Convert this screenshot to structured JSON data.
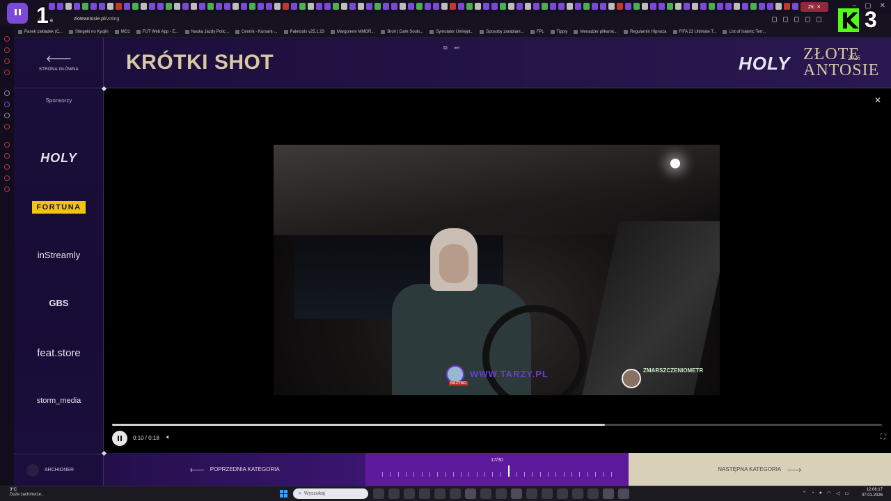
{
  "browser": {
    "url_host": "zloteantosie.pl",
    "url_path": "/voting",
    "active_tab_label": "Złc",
    "bookmarks": [
      "Pasek zakładek (C...",
      "Stingeki no Kyojin",
      "MO1",
      "FUT Web App - E...",
      "Nauka Jazdy Polic...",
      "Cennik - Kursant-...",
      "Paletools v25.1.23",
      "Margonem MMOR...",
      "Broń | Dark Souls...",
      "Symulator Umiejęt...",
      "Sposoby zarabiani...",
      "FPL",
      "Tipply",
      "Menadżer piłkarsk...",
      "Regulamin Hipnoza",
      "FIFA 22 Ultimate T...",
      "List of Islamic Terr..."
    ]
  },
  "sidebar": {
    "home_label": "STRONA GŁÓWNA",
    "sponsors_title": "Sponsorzy",
    "sponsors": {
      "holy": "HOLY",
      "fortuna": "FORTUNA",
      "instreamly": "inStreamly",
      "gbs": "GBS",
      "featstore": "feat.store",
      "storm": "storm_media"
    },
    "user_label": "ARCHIONER"
  },
  "header": {
    "title": "KRÓTKI SHOT",
    "brand_holy": "HOLY",
    "brand_line1": "ZŁOTE",
    "brand_line2": "ANTOSIE",
    "brand_year": "2025"
  },
  "player": {
    "time_label": "0:10 / 0:18",
    "progress": 0.64,
    "watermark": "WWW.TARZY.PL",
    "live_badge": "NA ŻYWO",
    "cam_name": "ZMARSZCZENIOMETR"
  },
  "footer": {
    "prev_label": "POPRZEDNIA KATEGORIA",
    "next_label": "NASTĘPNA KATEGORIA",
    "counter": "17/30",
    "current_index": 17,
    "total": 30
  },
  "taskbar": {
    "weather_temp": "3°C",
    "weather_desc": "Duże zachmurze...",
    "search_placeholder": "Wyszukaj",
    "time": "12:06:17",
    "date": "07.01.2026"
  },
  "overlay": {
    "left_number": "1",
    "right_number": "3"
  },
  "colors": {
    "accent_gold": "#d9c9a3",
    "accent_purple": "#5d1a9c",
    "sidebar_bg": "#1a0f3a"
  }
}
